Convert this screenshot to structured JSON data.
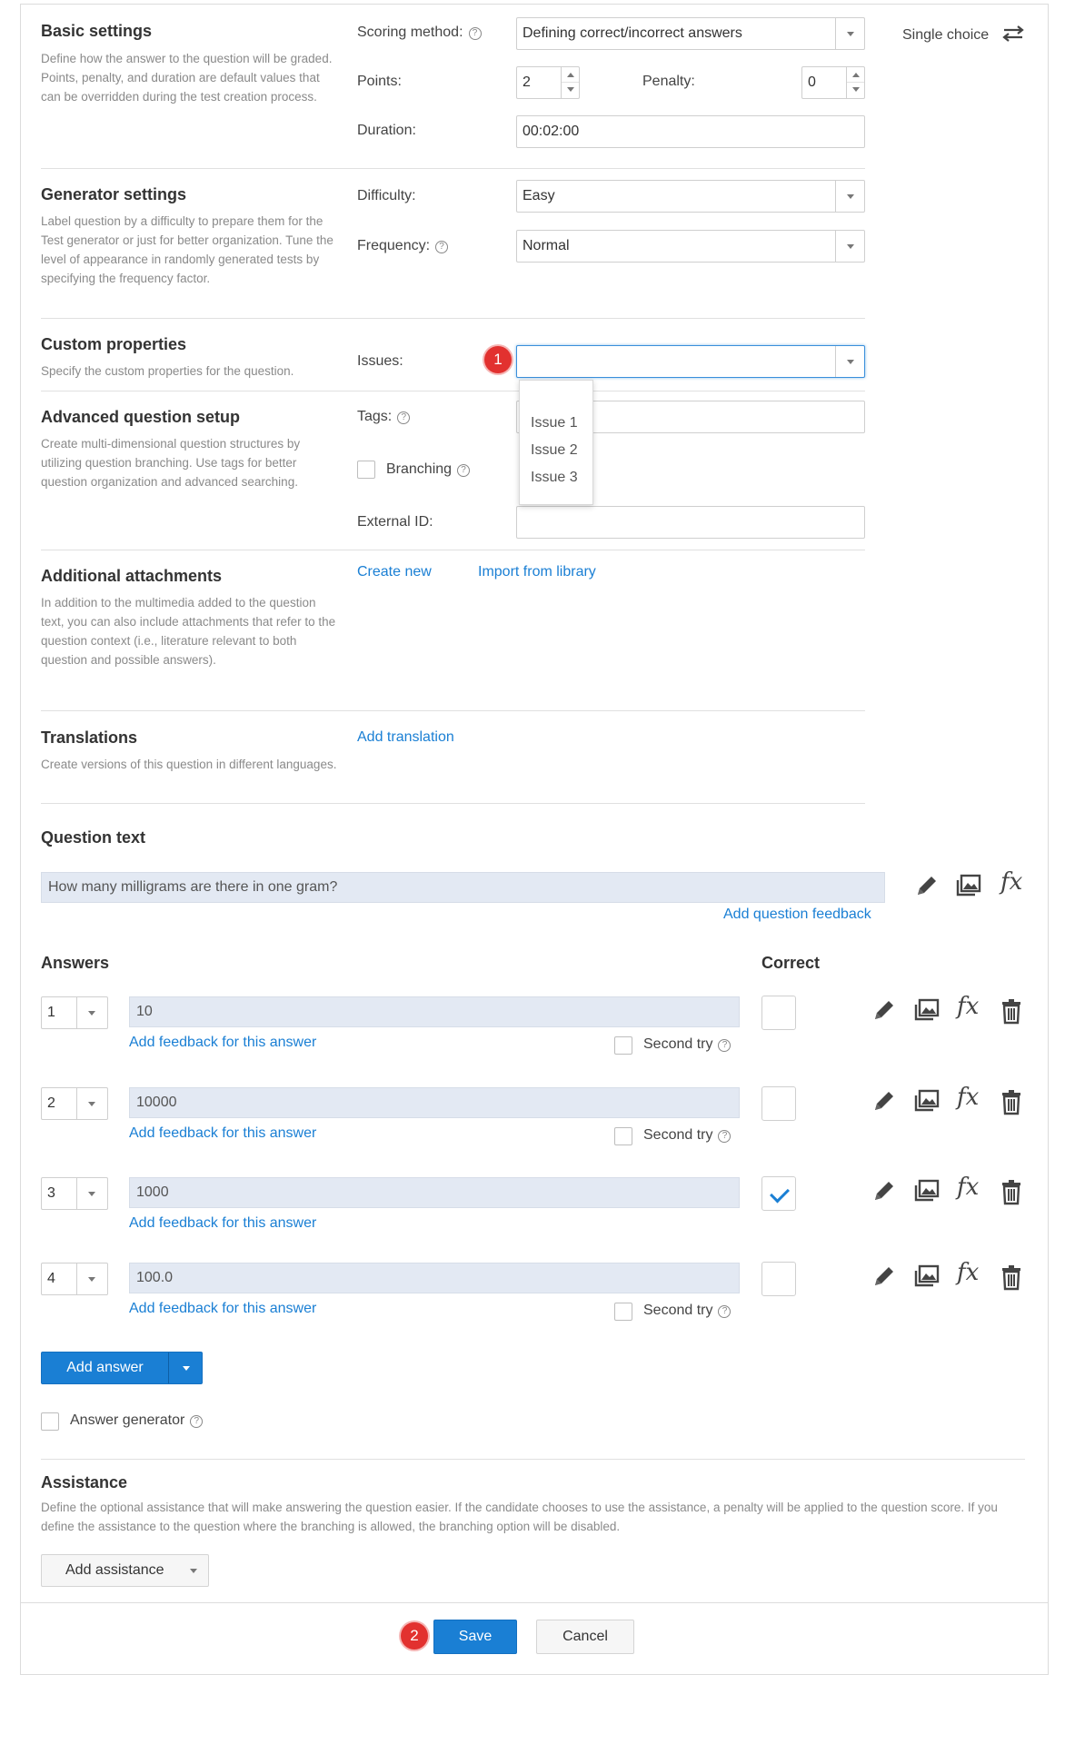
{
  "basic_settings": {
    "title": "Basic settings",
    "description": "Define how the answer to the question will be graded. Points, penalty, and duration are default values that can be overridden during the test creation process.",
    "scoring_method_label": "Scoring method:",
    "scoring_method_value": "Defining correct/incorrect answers",
    "question_type": "Single choice",
    "points_label": "Points:",
    "points_value": "2",
    "penalty_label": "Penalty:",
    "penalty_value": "0",
    "duration_label": "Duration:",
    "duration_value": "00:02:00"
  },
  "generator_settings": {
    "title": "Generator settings",
    "description": "Label question by a difficulty to prepare them for the Test generator or just for better organization. Tune the level of appearance in randomly generated tests by specifying the frequency factor.",
    "difficulty_label": "Difficulty:",
    "difficulty_value": "Easy",
    "frequency_label": "Frequency:",
    "frequency_value": "Normal"
  },
  "custom_properties": {
    "title": "Custom properties",
    "description": "Specify the custom properties for the question.",
    "issues_label": "Issues:",
    "issues_value": "",
    "issues_badge": "1",
    "issues_options": [
      "Issue 1",
      "Issue 2",
      "Issue 3"
    ]
  },
  "advanced_setup": {
    "title": "Advanced question setup",
    "description": "Create multi-dimensional question structures by utilizing question branching. Use tags for better question organization and advanced searching.",
    "tags_label": "Tags:",
    "branching_label": "Branching",
    "external_id_label": "External ID:"
  },
  "attachments": {
    "title": "Additional attachments",
    "description": "In addition to the multimedia added to the question text, you can also include attachments that refer to the question context (i.e., literature relevant to both question and possible answers).",
    "create_new": "Create new",
    "import_library": "Import from library"
  },
  "translations": {
    "title": "Translations",
    "description": "Create versions of this question in different languages.",
    "add_translation": "Add translation"
  },
  "question_text": {
    "title": "Question text",
    "value": "How many milligrams are there in one gram?",
    "add_feedback": "Add question feedback"
  },
  "answers": {
    "title": "Answers",
    "correct_header": "Correct",
    "feedback_link": "Add feedback for this answer",
    "second_try_label": "Second try",
    "items": [
      {
        "order": "1",
        "value": "10",
        "correct": false
      },
      {
        "order": "2",
        "value": "10000",
        "correct": false
      },
      {
        "order": "3",
        "value": "1000",
        "correct": true
      },
      {
        "order": "4",
        "value": "100.0",
        "correct": false
      }
    ],
    "add_answer": "Add answer",
    "answer_generator": "Answer generator"
  },
  "assistance": {
    "title": "Assistance",
    "description": "Define the optional assistance that will make answering the question easier. If the candidate chooses to use the assistance, a penalty will be applied to the question score. If you define the assistance to the question where the branching is allowed, the branching option will be disabled.",
    "add_assistance": "Add assistance"
  },
  "footer": {
    "save": "Save",
    "cancel": "Cancel",
    "save_badge": "2"
  },
  "colors": {
    "accent": "#1a7fd4",
    "badge": "#e2312f",
    "answer_field_bg": "#e3e9f3"
  }
}
